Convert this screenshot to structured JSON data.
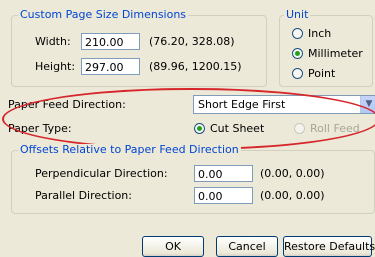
{
  "custom_size": {
    "legend": "Custom Page Size Dimensions",
    "width_label": "Width:",
    "width_value": "210.00",
    "width_range": "(76.20, 328.08)",
    "height_label": "Height:",
    "height_value": "297.00",
    "height_range": "(89.96, 1200.15)"
  },
  "unit": {
    "legend": "Unit",
    "options": [
      {
        "label": "Inch",
        "selected": false
      },
      {
        "label": "Millimeter",
        "selected": true
      },
      {
        "label": "Point",
        "selected": false
      }
    ]
  },
  "paper_feed": {
    "label": "Paper Feed Direction:",
    "value": "Short Edge First"
  },
  "paper_type": {
    "label": "Paper Type:",
    "options": [
      {
        "label": "Cut Sheet",
        "selected": true,
        "enabled": true
      },
      {
        "label": "Roll Feed",
        "selected": false,
        "enabled": false
      }
    ]
  },
  "offsets": {
    "legend": "Offsets Relative to Paper Feed Direction",
    "perpendicular_label": "Perpendicular Direction:",
    "perpendicular_value": "0.00",
    "perpendicular_range": "(0.00, 0.00)",
    "parallel_label": "Parallel Direction:",
    "parallel_value": "0.00",
    "parallel_range": "(0.00, 0.00)"
  },
  "buttons": {
    "ok": "OK",
    "cancel": "Cancel",
    "restore": "Restore Defaults"
  },
  "colors": {
    "annotation": "#d6262b",
    "group_title": "#0046d5"
  }
}
